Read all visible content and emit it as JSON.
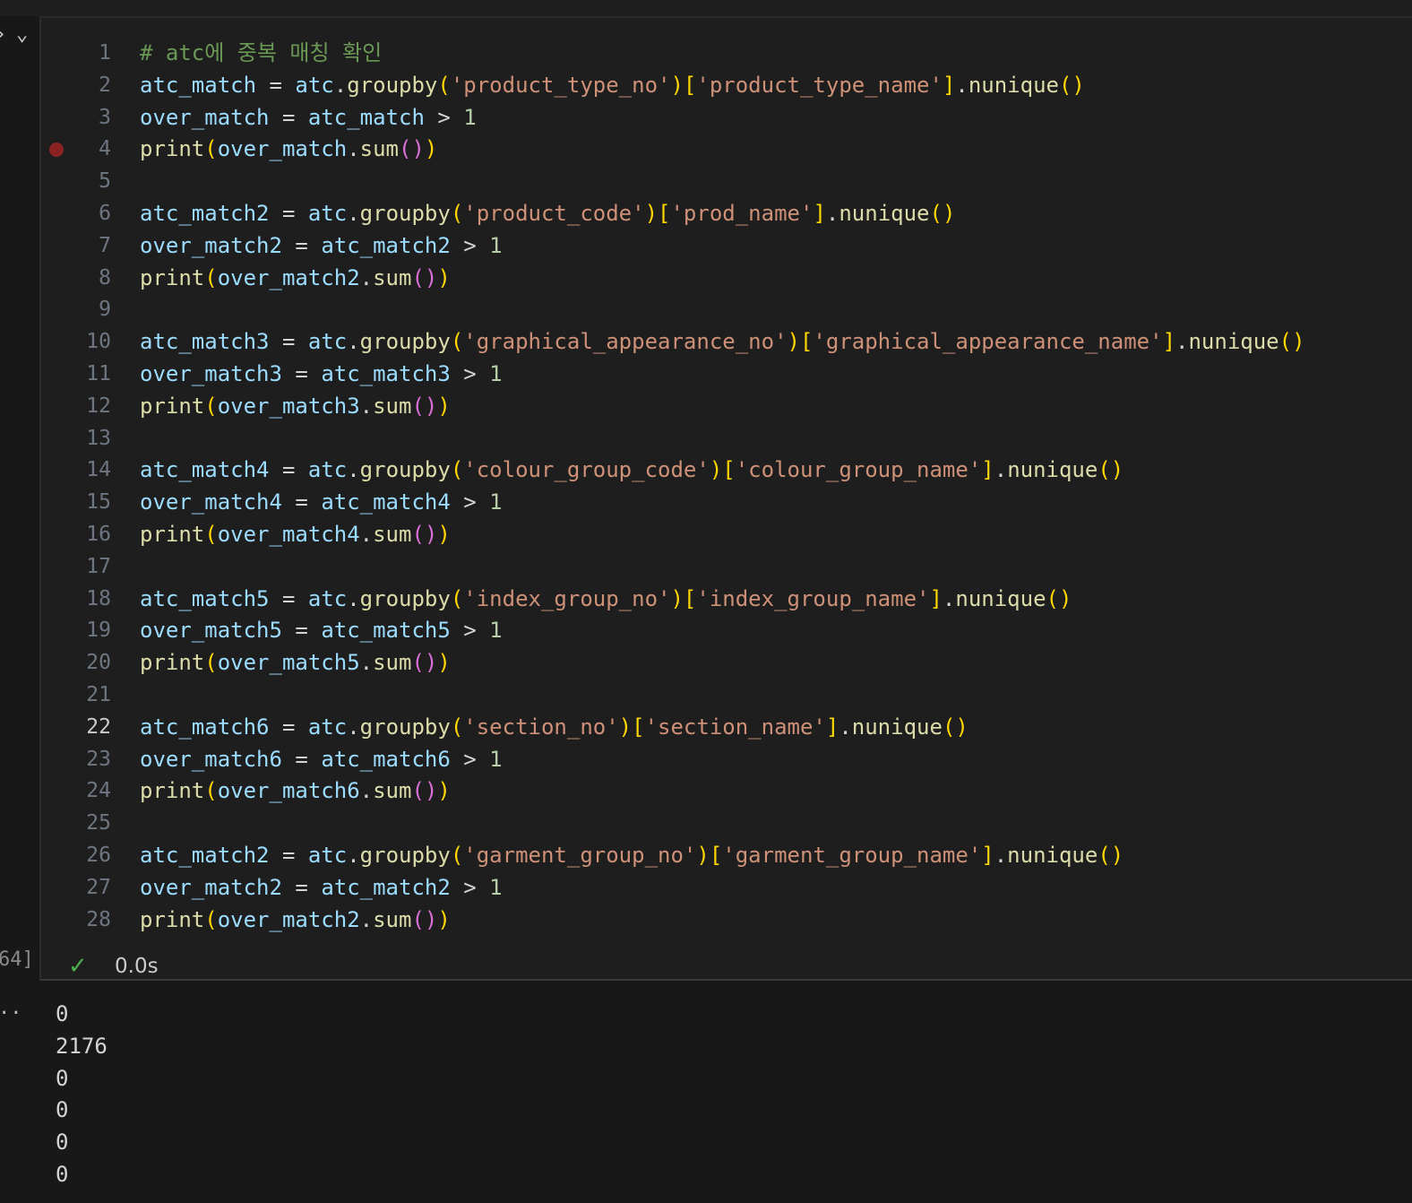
{
  "cell": {
    "execution_count": "64]",
    "status_duration": "0.0s",
    "active_line": 22,
    "breakpoint_line": 4,
    "code_lines": [
      [
        [
          "# atc에 중복 매칭 확인",
          "com"
        ]
      ],
      [
        [
          "atc_match",
          "var"
        ],
        [
          " = ",
          "op"
        ],
        [
          "atc",
          "var"
        ],
        [
          ".",
          "op"
        ],
        [
          "groupby",
          "fn"
        ],
        [
          "(",
          "b1"
        ],
        [
          "'product_type_no'",
          "str"
        ],
        [
          ")",
          "b1"
        ],
        [
          "[",
          "b1"
        ],
        [
          "'product_type_name'",
          "str"
        ],
        [
          "]",
          "b1"
        ],
        [
          ".",
          "op"
        ],
        [
          "nunique",
          "fn"
        ],
        [
          "()",
          "b1"
        ]
      ],
      [
        [
          "over_match",
          "var"
        ],
        [
          " = ",
          "op"
        ],
        [
          "atc_match",
          "var"
        ],
        [
          " > ",
          "op"
        ],
        [
          "1",
          "num"
        ]
      ],
      [
        [
          "print",
          "fn"
        ],
        [
          "(",
          "b1"
        ],
        [
          "over_match",
          "var"
        ],
        [
          ".",
          "op"
        ],
        [
          "sum",
          "fn"
        ],
        [
          "()",
          "b2"
        ],
        [
          ")",
          "b1"
        ]
      ],
      [],
      [
        [
          "atc_match2",
          "var"
        ],
        [
          " = ",
          "op"
        ],
        [
          "atc",
          "var"
        ],
        [
          ".",
          "op"
        ],
        [
          "groupby",
          "fn"
        ],
        [
          "(",
          "b1"
        ],
        [
          "'product_code'",
          "str"
        ],
        [
          ")",
          "b1"
        ],
        [
          "[",
          "b1"
        ],
        [
          "'prod_name'",
          "str"
        ],
        [
          "]",
          "b1"
        ],
        [
          ".",
          "op"
        ],
        [
          "nunique",
          "fn"
        ],
        [
          "()",
          "b1"
        ]
      ],
      [
        [
          "over_match2",
          "var"
        ],
        [
          " = ",
          "op"
        ],
        [
          "atc_match2",
          "var"
        ],
        [
          " > ",
          "op"
        ],
        [
          "1",
          "num"
        ]
      ],
      [
        [
          "print",
          "fn"
        ],
        [
          "(",
          "b1"
        ],
        [
          "over_match2",
          "var"
        ],
        [
          ".",
          "op"
        ],
        [
          "sum",
          "fn"
        ],
        [
          "()",
          "b2"
        ],
        [
          ")",
          "b1"
        ]
      ],
      [],
      [
        [
          "atc_match3",
          "var"
        ],
        [
          " = ",
          "op"
        ],
        [
          "atc",
          "var"
        ],
        [
          ".",
          "op"
        ],
        [
          "groupby",
          "fn"
        ],
        [
          "(",
          "b1"
        ],
        [
          "'graphical_appearance_no'",
          "str"
        ],
        [
          ")",
          "b1"
        ],
        [
          "[",
          "b1"
        ],
        [
          "'graphical_appearance_name'",
          "str"
        ],
        [
          "]",
          "b1"
        ],
        [
          ".",
          "op"
        ],
        [
          "nunique",
          "fn"
        ],
        [
          "()",
          "b1"
        ]
      ],
      [
        [
          "over_match3",
          "var"
        ],
        [
          " = ",
          "op"
        ],
        [
          "atc_match3",
          "var"
        ],
        [
          " > ",
          "op"
        ],
        [
          "1",
          "num"
        ]
      ],
      [
        [
          "print",
          "fn"
        ],
        [
          "(",
          "b1"
        ],
        [
          "over_match3",
          "var"
        ],
        [
          ".",
          "op"
        ],
        [
          "sum",
          "fn"
        ],
        [
          "()",
          "b2"
        ],
        [
          ")",
          "b1"
        ]
      ],
      [],
      [
        [
          "atc_match4",
          "var"
        ],
        [
          " = ",
          "op"
        ],
        [
          "atc",
          "var"
        ],
        [
          ".",
          "op"
        ],
        [
          "groupby",
          "fn"
        ],
        [
          "(",
          "b1"
        ],
        [
          "'colour_group_code'",
          "str"
        ],
        [
          ")",
          "b1"
        ],
        [
          "[",
          "b1"
        ],
        [
          "'colour_group_name'",
          "str"
        ],
        [
          "]",
          "b1"
        ],
        [
          ".",
          "op"
        ],
        [
          "nunique",
          "fn"
        ],
        [
          "()",
          "b1"
        ]
      ],
      [
        [
          "over_match4",
          "var"
        ],
        [
          " = ",
          "op"
        ],
        [
          "atc_match4",
          "var"
        ],
        [
          " > ",
          "op"
        ],
        [
          "1",
          "num"
        ]
      ],
      [
        [
          "print",
          "fn"
        ],
        [
          "(",
          "b1"
        ],
        [
          "over_match4",
          "var"
        ],
        [
          ".",
          "op"
        ],
        [
          "sum",
          "fn"
        ],
        [
          "()",
          "b2"
        ],
        [
          ")",
          "b1"
        ]
      ],
      [],
      [
        [
          "atc_match5",
          "var"
        ],
        [
          " = ",
          "op"
        ],
        [
          "atc",
          "var"
        ],
        [
          ".",
          "op"
        ],
        [
          "groupby",
          "fn"
        ],
        [
          "(",
          "b1"
        ],
        [
          "'index_group_no'",
          "str"
        ],
        [
          ")",
          "b1"
        ],
        [
          "[",
          "b1"
        ],
        [
          "'index_group_name'",
          "str"
        ],
        [
          "]",
          "b1"
        ],
        [
          ".",
          "op"
        ],
        [
          "nunique",
          "fn"
        ],
        [
          "()",
          "b1"
        ]
      ],
      [
        [
          "over_match5",
          "var"
        ],
        [
          " = ",
          "op"
        ],
        [
          "atc_match5",
          "var"
        ],
        [
          " > ",
          "op"
        ],
        [
          "1",
          "num"
        ]
      ],
      [
        [
          "print",
          "fn"
        ],
        [
          "(",
          "b1"
        ],
        [
          "over_match5",
          "var"
        ],
        [
          ".",
          "op"
        ],
        [
          "sum",
          "fn"
        ],
        [
          "()",
          "b2"
        ],
        [
          ")",
          "b1"
        ]
      ],
      [],
      [
        [
          "atc_match6",
          "var"
        ],
        [
          " = ",
          "op"
        ],
        [
          "atc",
          "var"
        ],
        [
          ".",
          "op"
        ],
        [
          "groupby",
          "fn"
        ],
        [
          "(",
          "b1"
        ],
        [
          "'section_no'",
          "str"
        ],
        [
          ")",
          "b1"
        ],
        [
          "[",
          "b1"
        ],
        [
          "'section_name'",
          "str"
        ],
        [
          "]",
          "b1"
        ],
        [
          ".",
          "op"
        ],
        [
          "nunique",
          "fn"
        ],
        [
          "()",
          "b1"
        ]
      ],
      [
        [
          "over_match6",
          "var"
        ],
        [
          " = ",
          "op"
        ],
        [
          "atc_match6",
          "var"
        ],
        [
          " > ",
          "op"
        ],
        [
          "1",
          "num"
        ]
      ],
      [
        [
          "print",
          "fn"
        ],
        [
          "(",
          "b1"
        ],
        [
          "over_match6",
          "var"
        ],
        [
          ".",
          "op"
        ],
        [
          "sum",
          "fn"
        ],
        [
          "()",
          "b2"
        ],
        [
          ")",
          "b1"
        ]
      ],
      [],
      [
        [
          "atc_match2",
          "var"
        ],
        [
          " = ",
          "op"
        ],
        [
          "atc",
          "var"
        ],
        [
          ".",
          "op"
        ],
        [
          "groupby",
          "fn"
        ],
        [
          "(",
          "b1"
        ],
        [
          "'garment_group_no'",
          "str"
        ],
        [
          ")",
          "b1"
        ],
        [
          "[",
          "b1"
        ],
        [
          "'garment_group_name'",
          "str"
        ],
        [
          "]",
          "b1"
        ],
        [
          ".",
          "op"
        ],
        [
          "nunique",
          "fn"
        ],
        [
          "()",
          "b1"
        ]
      ],
      [
        [
          "over_match2",
          "var"
        ],
        [
          " = ",
          "op"
        ],
        [
          "atc_match2",
          "var"
        ],
        [
          " > ",
          "op"
        ],
        [
          "1",
          "num"
        ]
      ],
      [
        [
          "print",
          "fn"
        ],
        [
          "(",
          "b1"
        ],
        [
          "over_match2",
          "var"
        ],
        [
          ".",
          "op"
        ],
        [
          "sum",
          "fn"
        ],
        [
          "()",
          "b2"
        ],
        [
          ")",
          "b1"
        ]
      ]
    ]
  },
  "output": {
    "dots": "..",
    "lines": [
      "0",
      "2176",
      "0",
      "0",
      "0",
      "0"
    ]
  },
  "icons": {
    "collapse": "chevron-right-icon",
    "expand": "chevron-down-icon",
    "success": "check-icon",
    "breakpoint": "breakpoint-dot-icon"
  },
  "colors": {
    "background": "#1e1e1e",
    "comment": "#6a9955",
    "variable": "#9cdcfe",
    "function": "#dcdcaa",
    "string": "#ce9178",
    "number": "#b5cea8",
    "bracket_level1": "#ffd700",
    "bracket_level2": "#da70d6",
    "success": "#4caf50",
    "breakpoint": "#8b2222"
  }
}
